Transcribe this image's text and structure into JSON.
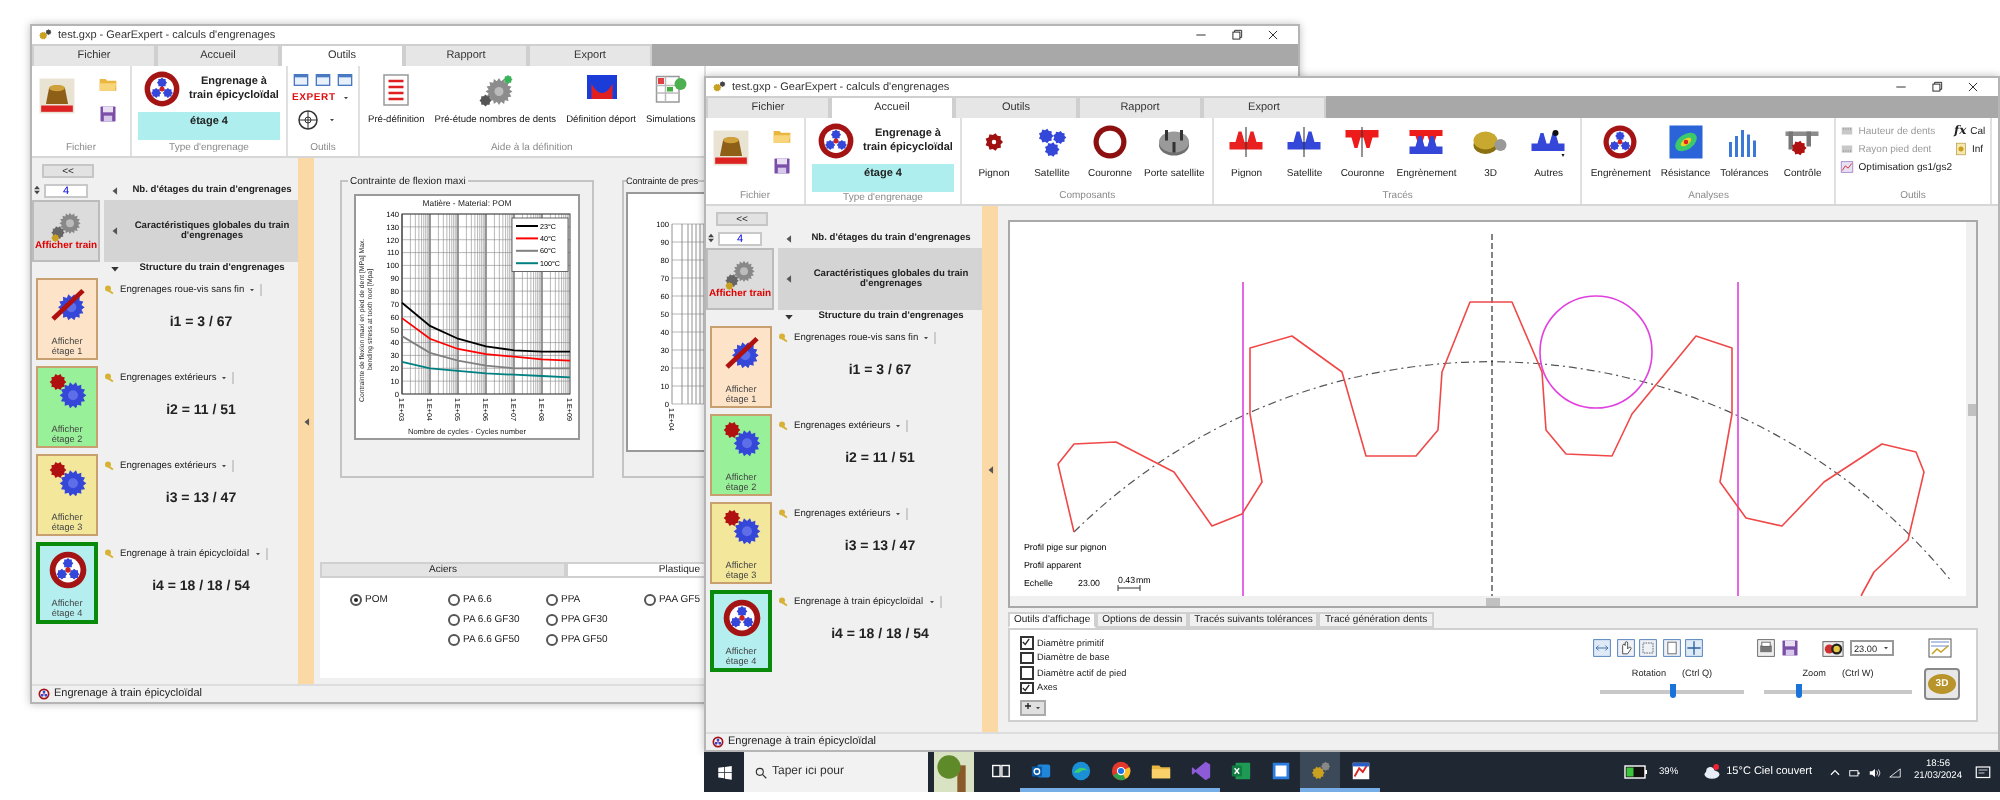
{
  "windows": [
    {
      "title": "test.gxp - GearExpert - calculs d'engrenages",
      "tabs": [
        {
          "label": "Fichier",
          "selected": false
        },
        {
          "label": "Accueil",
          "selected": false
        },
        {
          "label": "Outils",
          "selected": true
        },
        {
          "label": "Rapport",
          "selected": false
        },
        {
          "label": "Export",
          "selected": false
        }
      ],
      "ribbon": {
        "groups": [
          {
            "label": "Fichier",
            "items": [
              {
                "kind": "logo"
              },
              {
                "kind": "stack",
                "items": [
                  {
                    "kind": "open"
                  },
                  {
                    "kind": "save"
                  }
                ]
              }
            ]
          },
          {
            "label": "Type d'engrenage",
            "items": [
              {
                "kind": "gear-type",
                "title": "Engrenage à train épicycloïdal",
                "stage": "étage 4"
              }
            ]
          },
          {
            "label": "Outils",
            "items": [
              {
                "kind": "stack",
                "items": [
                  {
                    "kind": "mini-tools"
                  },
                  {
                    "kind": "dropdown",
                    "label": "EXPERT"
                  },
                  {
                    "kind": "gear-dropdown"
                  }
                ]
              }
            ]
          },
          {
            "label": "Aide à la définition",
            "items": [
              {
                "kind": "predef",
                "label": "Pré-définition"
              },
              {
                "kind": "prestudy",
                "label": "Pré-étude nombres de dents"
              },
              {
                "kind": "deport",
                "label": "Définition déport"
              },
              {
                "kind": "simulations",
                "label": "Simulations"
              }
            ]
          }
        ]
      },
      "sidebar": {
        "collapse": "<<",
        "stage_count": "4",
        "sections": [
          {
            "label": "Nb. d'étages du train d'engrenages",
            "expanded": false,
            "selected": false
          },
          {
            "label": "Caractéristiques globales du train d'engrenages",
            "expanded": false,
            "selected": true
          },
          {
            "label": "Structure du train d'engrenages",
            "expanded": true,
            "selected": false
          }
        ],
        "train_tile": "Afficher train",
        "stages": [
          {
            "kind": "worm",
            "tile": "Afficher étage 1",
            "color": "#fde3c8",
            "type": "Engrenages roue-vis sans fin",
            "ratio": "i1 = 3 / 67",
            "selected": false
          },
          {
            "kind": "external",
            "tile": "Afficher étage 2",
            "color": "#98f098",
            "type": "Engrenages extérieurs",
            "ratio": "i2 = 11 / 51",
            "selected": false
          },
          {
            "kind": "external",
            "tile": "Afficher étage 3",
            "color": "#f3e79c",
            "type": "Engrenages extérieurs",
            "ratio": "i3 = 13 / 47",
            "selected": false
          },
          {
            "kind": "planetary",
            "tile": "Afficher étage 4",
            "color": "#b4eeee",
            "type": "Engrenage à train épicycloïdal",
            "ratio": "i4 = 18 / 18 / 54",
            "selected": true
          }
        ]
      },
      "view": {
        "kind": "materials",
        "chart_panel": {
          "title": "Contrainte de flexion maxi",
          "chart_data": {
            "type": "line",
            "title": "Matière - Material: POM",
            "xlabel": "Nombre de cycles - Cycles number",
            "ylabel": "Contrainte de flexion maxi en pied de dent [MPa] Max. bending stress at tooth root [Mpa]",
            "grid": true,
            "legend": true,
            "categories": [
              "1.E+03",
              "1.E+04",
              "1.E+05",
              "1.E+06",
              "1.E+07",
              "1.E+08",
              "1.E+09"
            ],
            "ylim": [
              0,
              140
            ],
            "yticks": [
              0,
              10,
              20,
              30,
              40,
              50,
              60,
              70,
              80,
              90,
              100,
              110,
              120,
              130,
              140
            ],
            "series": [
              {
                "name": "23°C",
                "color": "#000000",
                "values": [
                  71,
                  53,
                  43,
                  37,
                  34,
                  33,
                  33
                ]
              },
              {
                "name": "40°C",
                "color": "#ff0000",
                "values": [
                  59,
                  43,
                  35,
                  31,
                  29,
                  27,
                  26
                ]
              },
              {
                "name": "60°C",
                "color": "#808080",
                "values": [
                  45,
                  32,
                  26,
                  22,
                  20,
                  20,
                  20
                ]
              },
              {
                "name": "100°C",
                "color": "#008080",
                "values": [
                  25,
                  20,
                  18,
                  16,
                  15,
                  14,
                  13
                ]
              }
            ]
          }
        },
        "partial_panel": {
          "title": "Contrainte de pres",
          "yticks": [
            "100",
            "90",
            "80",
            "70",
            "60",
            "50",
            "40",
            "30",
            "20",
            "10",
            "0"
          ],
          "xtick": "1.E+04"
        },
        "material_tabs": [
          {
            "label": "Aciers",
            "selected": false
          },
          {
            "label": "Plastique",
            "selected": true
          }
        ],
        "material_columns": [
          [
            {
              "label": "POM",
              "selected": true
            }
          ],
          [
            {
              "label": "PA 6.6",
              "selected": false
            },
            {
              "label": "PA 6.6 GF30",
              "selected": false
            },
            {
              "label": "PA 6.6 GF50",
              "selected": false
            }
          ],
          [
            {
              "label": "PPA",
              "selected": false
            },
            {
              "label": "PPA GF30",
              "selected": false
            },
            {
              "label": "PPA GF50",
              "selected": false
            }
          ],
          [
            {
              "label": "PAA GF5",
              "selected": false
            }
          ]
        ]
      },
      "status": "Engrenage à train épicycloïdal"
    },
    {
      "title": "test.gxp - GearExpert - calculs d'engrenages",
      "tabs": [
        {
          "label": "Fichier",
          "selected": false
        },
        {
          "label": "Accueil",
          "selected": true
        },
        {
          "label": "Outils",
          "selected": false
        },
        {
          "label": "Rapport",
          "selected": false
        },
        {
          "label": "Export",
          "selected": false
        }
      ],
      "ribbon": {
        "groups": [
          {
            "label": "Fichier",
            "items": [
              {
                "kind": "logo"
              },
              {
                "kind": "stack",
                "items": [
                  {
                    "kind": "open"
                  },
                  {
                    "kind": "save"
                  }
                ]
              }
            ]
          },
          {
            "label": "Type d'engrenage",
            "items": [
              {
                "kind": "gear-type",
                "title": "Engrenage à train épicycloïdal",
                "stage": "étage 4"
              }
            ]
          },
          {
            "label": "Composants",
            "items": [
              {
                "kind": "pinion",
                "label": "Pignon"
              },
              {
                "kind": "satellite",
                "label": "Satellite"
              },
              {
                "kind": "ring",
                "label": "Couronne"
              },
              {
                "kind": "carrier",
                "label": "Porte satellite"
              }
            ]
          },
          {
            "label": "Tracés",
            "items": [
              {
                "kind": "trace-pinion",
                "label": "Pignon"
              },
              {
                "kind": "trace-satellite",
                "label": "Satellite"
              },
              {
                "kind": "trace-ring",
                "label": "Couronne"
              },
              {
                "kind": "trace-mesh",
                "label": "Engrènement"
              },
              {
                "kind": "solid",
                "label": "3D"
              },
              {
                "kind": "others",
                "label": "Autres"
              }
            ]
          },
          {
            "label": "Analyses",
            "items": [
              {
                "kind": "planetary",
                "label": "Engrènement"
              },
              {
                "kind": "resistance",
                "label": "Résistance"
              },
              {
                "kind": "tolerances",
                "label": "Tolérances"
              },
              {
                "kind": "control",
                "label": "Contrôle"
              }
            ]
          },
          {
            "label": "Outils",
            "items": [
              {
                "kind": "stack",
                "items": [
                  {
                    "kind": "height",
                    "label": "Hauteur de dents",
                    "disabled": true
                  },
                  {
                    "kind": "radius",
                    "label": "Rayon pied dent",
                    "disabled": true
                  },
                  {
                    "kind": "optim",
                    "label": "Optimisation gs1/gs2",
                    "disabled": false
                  }
                ]
              },
              {
                "kind": "stack",
                "items": [
                  {
                    "kind": "formula",
                    "glyph": "fx",
                    "label": "Cal",
                    "disabled": false
                  },
                  {
                    "kind": "info",
                    "label": "Inf",
                    "disabled": false
                  }
                ]
              }
            ]
          }
        ]
      },
      "sidebar": {
        "collapse": "<<",
        "stage_count": "4",
        "sections": [
          {
            "label": "Nb. d'étages du train d'engrenages",
            "expanded": false,
            "selected": false
          },
          {
            "label": "Caractéristiques globales du train d'engrenages",
            "expanded": false,
            "selected": true
          },
          {
            "label": "Structure du train d'engrenages",
            "expanded": true,
            "selected": false
          }
        ],
        "train_tile": "Afficher train",
        "stages": [
          {
            "kind": "worm",
            "tile": "Afficher étage 1",
            "color": "#fde3c8",
            "type": "Engrenages roue-vis sans fin",
            "ratio": "i1 = 3 / 67",
            "selected": false
          },
          {
            "kind": "external",
            "tile": "Afficher étage 2",
            "color": "#98f098",
            "type": "Engrenages extérieurs",
            "ratio": "i2 = 11 / 51",
            "selected": false
          },
          {
            "kind": "external",
            "tile": "Afficher étage 3",
            "color": "#f3e79c",
            "type": "Engrenages extérieurs",
            "ratio": "i3 = 13 / 47",
            "selected": false
          },
          {
            "kind": "planetary",
            "tile": "Afficher étage 4",
            "color": "#b4eeee",
            "type": "Engrenage à train épicycloïdal",
            "ratio": "i4 = 18 / 18 / 54",
            "selected": true
          }
        ]
      },
      "view": {
        "kind": "gear",
        "canvas": {
          "notes": [
            "Profil pige sur pignon",
            "Profil apparent"
          ],
          "scale_label": "Echelle",
          "scale_value": "23.00",
          "bar_value": "0.43",
          "bar_unit": "mm"
        },
        "tabs": [
          {
            "label": "Outils d'affichage",
            "selected": true
          },
          {
            "label": "Options de dessin",
            "selected": false
          },
          {
            "label": "Tracés suivants tolérances",
            "selected": false
          },
          {
            "label": "Tracé génération dents",
            "selected": false
          }
        ],
        "checkboxes": [
          {
            "label": "Diamètre primitif",
            "checked": true
          },
          {
            "label": "Diamètre de base",
            "checked": false
          },
          {
            "label": "Diamètre actif de pied",
            "checked": false
          },
          {
            "label": "Axes",
            "checked": true
          }
        ],
        "add_button": "+",
        "scale_combo": "23.00",
        "sliders": [
          {
            "label": "Rotation",
            "shortcut": "(Ctrl Q)",
            "level": 0.5
          },
          {
            "label": "Zoom",
            "shortcut": "(Ctrl W)",
            "level": 0.24
          }
        ],
        "button_3d": "3D"
      },
      "status": "Engrenage à train épicycloïdal"
    }
  ],
  "taskbar": {
    "search": {
      "placeholder": "Taper ici pour"
    },
    "apps": [
      {
        "kind": "taskview",
        "running": false,
        "active": false
      },
      {
        "kind": "mail",
        "running": true,
        "active": false
      },
      {
        "kind": "edge",
        "running": true,
        "active": false
      },
      {
        "kind": "chrome",
        "running": true,
        "active": false
      },
      {
        "kind": "explorer",
        "running": true,
        "active": false
      },
      {
        "kind": "vs",
        "running": true,
        "active": false
      },
      {
        "kind": "excel",
        "running": false,
        "active": false
      },
      {
        "kind": "notes",
        "running": false,
        "active": false
      },
      {
        "kind": "gear",
        "running": true,
        "active": true
      },
      {
        "kind": "tool",
        "running": true,
        "active": false
      }
    ],
    "battery": "39%",
    "weather": "15°C Ciel couvert",
    "time": "18:56",
    "date": "21/03/2024"
  }
}
